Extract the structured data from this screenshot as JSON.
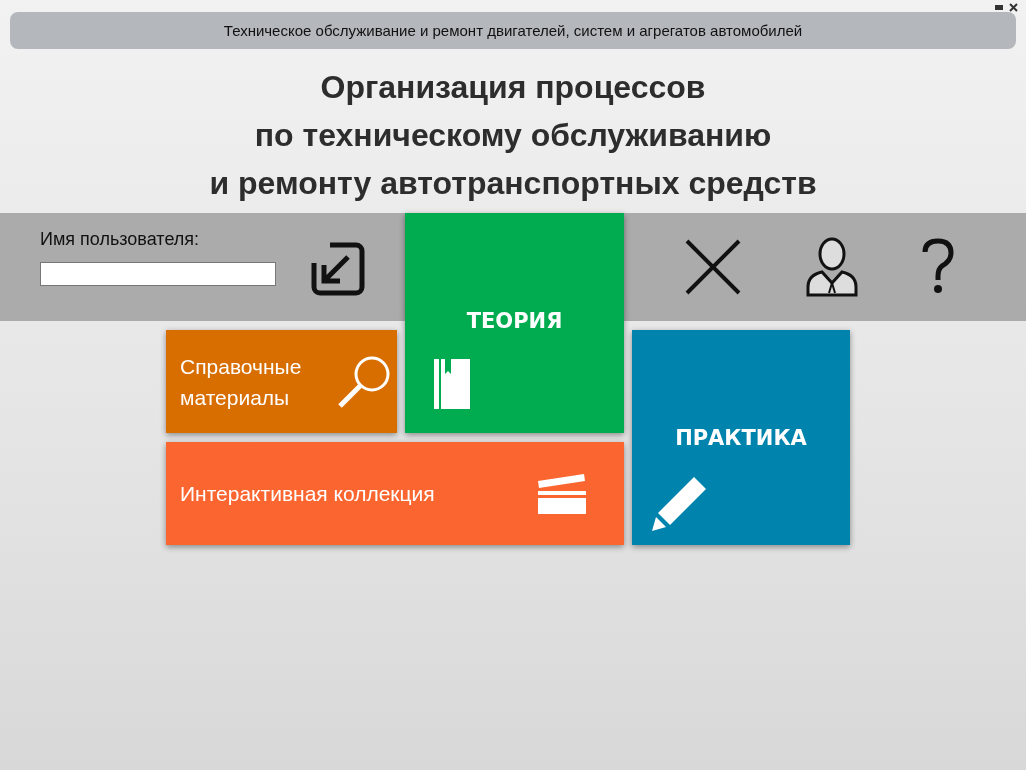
{
  "header": {
    "subtitle": "Техническое обслуживание и ремонт двигателей, систем и агрегатов автомобилей"
  },
  "title_lines": [
    "Организация процессов",
    "по техническому обслуживанию",
    "и ремонту автотранспортных средств"
  ],
  "login": {
    "label": "Имя пользователя:"
  },
  "tiles": [
    {
      "kind": "theory",
      "label": "ТЕОРИЯ",
      "color": "#00ac4f"
    },
    {
      "kind": "reference",
      "label": "Справочные материалы",
      "color": "#d86e00"
    },
    {
      "kind": "practice",
      "label": "ПРАКТИКА",
      "color": "#0083ad"
    },
    {
      "kind": "collection",
      "label": "Интерактивная коллекция",
      "color": "#fb6630"
    }
  ]
}
